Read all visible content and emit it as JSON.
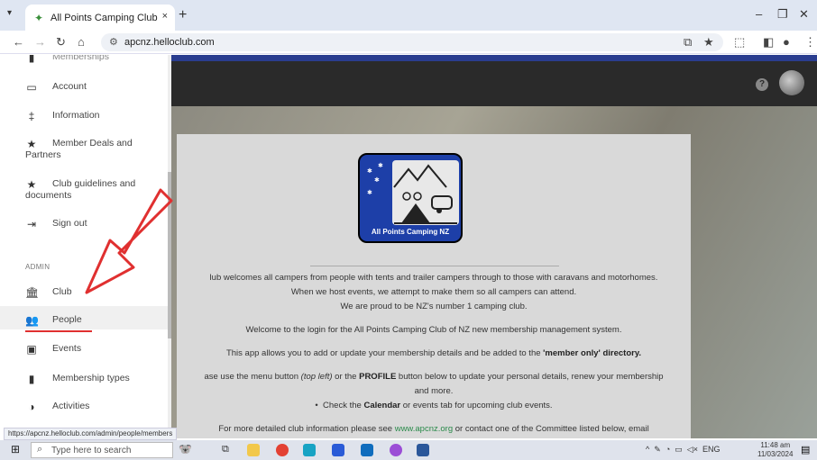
{
  "browser": {
    "tab_title": "All Points Camping Club of Ne",
    "new_tab": "+",
    "tab_close": "×",
    "url": "apcnz.helloclub.com"
  },
  "sidebar": {
    "partial_top_label": "Memberships",
    "items": [
      {
        "label": "Account",
        "icon": "credit-card-icon"
      },
      {
        "label": "Information",
        "icon": "signpost-icon"
      },
      {
        "label": "Member Deals and",
        "wrap": "Partners",
        "icon": "star-icon"
      },
      {
        "label": "Club guidelines and",
        "wrap": "documents",
        "icon": "star-icon"
      },
      {
        "label": "Sign out",
        "icon": "logout-icon"
      }
    ],
    "admin_heading": "ADMIN",
    "admin_items": [
      {
        "label": "Club",
        "icon": "bank-icon"
      },
      {
        "label": "People",
        "icon": "people-icon"
      },
      {
        "label": "Events",
        "icon": "calendar-icon"
      },
      {
        "label": "Membership types",
        "icon": "bookmark-icon"
      },
      {
        "label": "Activities",
        "icon": "toggle-icon"
      }
    ]
  },
  "card": {
    "logo_text": "All Points Camping NZ",
    "line1": "lub welcomes all campers from people with tents and trailer campers through to those with caravans and motorhomes.",
    "line2": "When we host events, we attempt to make them so all campers can attend.",
    "line3": "We are proud to be NZ's number 1 camping club.",
    "line4": "Welcome to the login for the All Points Camping Club of NZ new membership management system.",
    "line5_a": "This app allows you to add or update your membership details and be added to the ",
    "line5_b": "'member only' directory.",
    "line6_a": "ase use the menu button ",
    "line6_b": "(top left)",
    "line6_c": " or the ",
    "line6_d": "PROFILE",
    "line6_e": " button below to update your personal details, renew your membership",
    "line7": "and more.",
    "line8_a": "Check the ",
    "line8_b": "Calendar",
    "line8_c": " or events tab for upcoming club events.",
    "line9_a": "For more detailed club information please see ",
    "line9_link": "www.apcnz.org",
    "line9_b": " or contact one of the Committee listed below, email"
  },
  "status_url": "https://apcnz.helloclub.com/admin/people/members",
  "taskbar": {
    "search_placeholder": "Type here to search",
    "lang": "ENG",
    "time": "11:48 am",
    "date": "11/03/2024"
  },
  "colors": {
    "annotation_red": "#e03030",
    "brand_blue": "#1d3fa8",
    "link_green": "#2a8a4a"
  }
}
